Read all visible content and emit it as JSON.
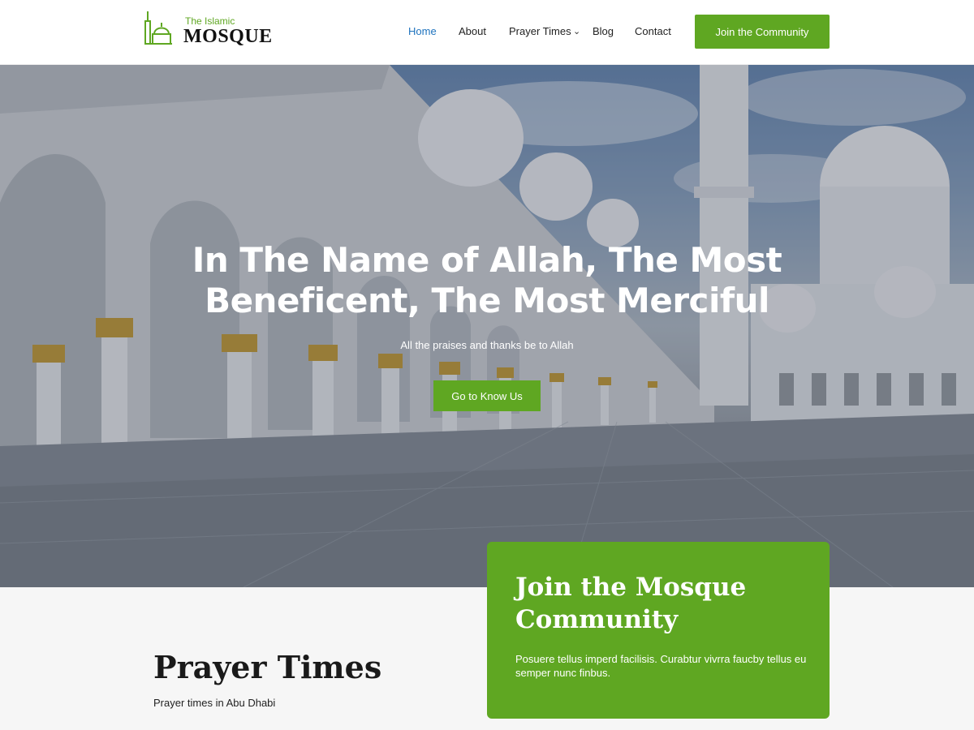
{
  "header": {
    "logo_small": "The Islamic",
    "logo_big": "MOSQUE",
    "nav": [
      {
        "label": "Home",
        "active": true
      },
      {
        "label": "About",
        "active": false
      },
      {
        "label": "Prayer Times",
        "active": false,
        "has_dropdown": true
      },
      {
        "label": "Blog",
        "active": false
      },
      {
        "label": "Contact",
        "active": false
      }
    ],
    "cta_label": "Join the Community"
  },
  "hero": {
    "title": "In The Name of Allah, The Most Beneficent, The Most Merciful",
    "subtitle": "All the praises and thanks be to Allah",
    "button_label": "Go to Know Us"
  },
  "prayer": {
    "title": "Prayer Times",
    "subtitle": "Prayer times in Abu Dhabi"
  },
  "community_card": {
    "title": "Join the Mosque Community",
    "text": "Posuere tellus imperd facilisis. Curabtur vivrra faucby tellus eu semper nunc finbus."
  },
  "colors": {
    "accent": "#5fa722",
    "nav_active": "#1e73be",
    "text_dark": "#1a1a1a"
  },
  "icons": {
    "logo": "mosque-icon",
    "dropdown": "chevron-down-icon"
  }
}
